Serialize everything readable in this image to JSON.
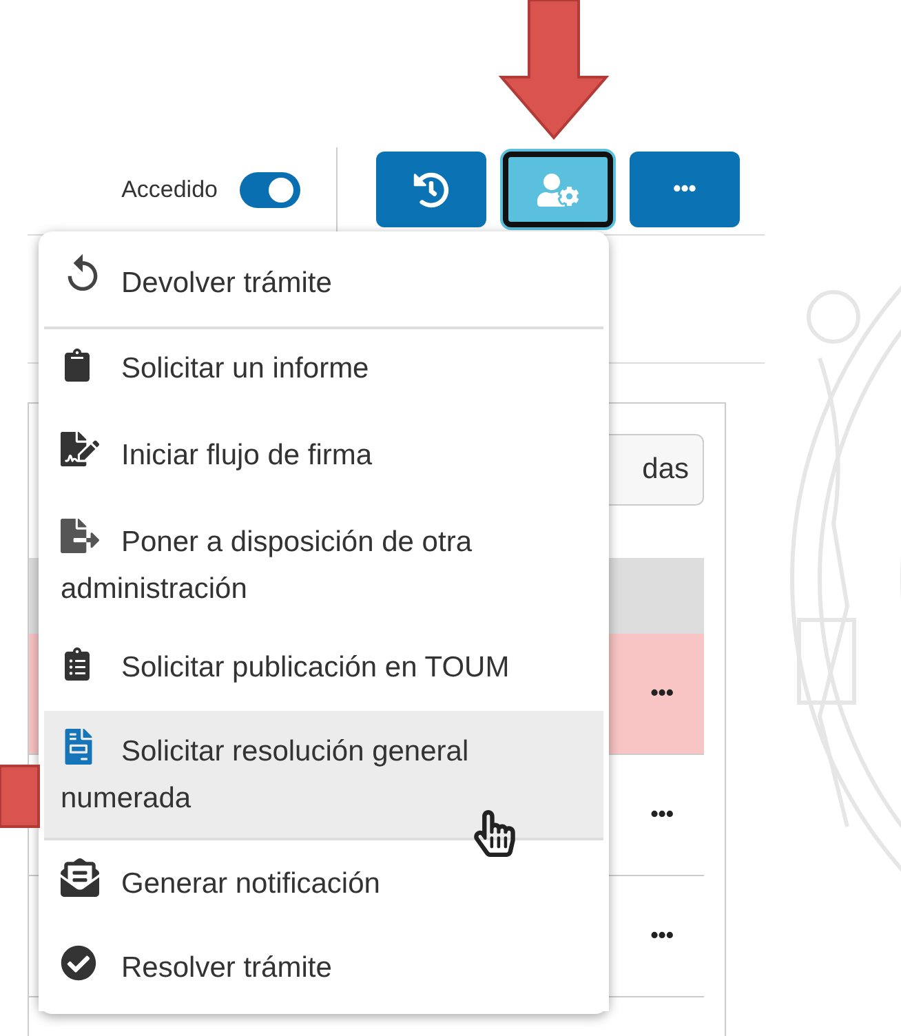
{
  "toolbar": {
    "toggle": {
      "label": "Accedido",
      "on": true
    },
    "buttons": [
      {
        "kind": "history",
        "selected": false
      },
      {
        "kind": "user-settings",
        "selected": true
      },
      {
        "kind": "more",
        "label": "•••",
        "selected": false
      }
    ]
  },
  "table": {
    "filter_button": "das",
    "rows": [
      {
        "action": "•••",
        "highlighted": true
      },
      {
        "action": "•••",
        "highlighted": false
      },
      {
        "action": "•••",
        "highlighted": false
      }
    ]
  },
  "menu": {
    "items": [
      {
        "label": "Devolver trámite",
        "hovered": false,
        "divider_after": true
      },
      {
        "label": "Solicitar un informe",
        "hovered": false,
        "divider_after": false
      },
      {
        "label": "Iniciar flujo de firma",
        "hovered": false,
        "divider_after": false
      },
      {
        "label": "Poner a disposición de otra administración",
        "hovered": false,
        "divider_after": false
      },
      {
        "label": "Solicitar publicación en TOUM",
        "hovered": false,
        "divider_after": false
      },
      {
        "label": "Solicitar resolución general numerada",
        "hovered": true,
        "divider_after": true
      },
      {
        "label": "Generar notificación",
        "hovered": false,
        "divider_after": false
      },
      {
        "label": "Resolver trámite",
        "hovered": false,
        "divider_after": false
      }
    ]
  }
}
